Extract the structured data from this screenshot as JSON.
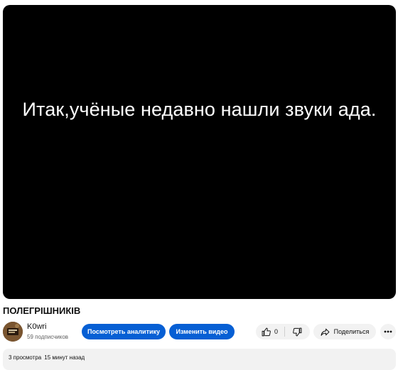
{
  "video": {
    "caption": "Итак,учёные недавно нашли звуки ада.",
    "title": "ПОЛЕГРІШНИКІВ"
  },
  "channel": {
    "name": "K0wri",
    "subscribers": "59 подписчиков",
    "avatar_icon": "channel-avatar-icon"
  },
  "actions": {
    "analytics_label": "Посмотреть аналитику",
    "edit_label": "Изменить видео",
    "like_count": "0",
    "share_label": "Поделиться",
    "accent_color": "#065fd4"
  },
  "description": {
    "views": "3 просмотра",
    "time": "15 минут назад"
  }
}
